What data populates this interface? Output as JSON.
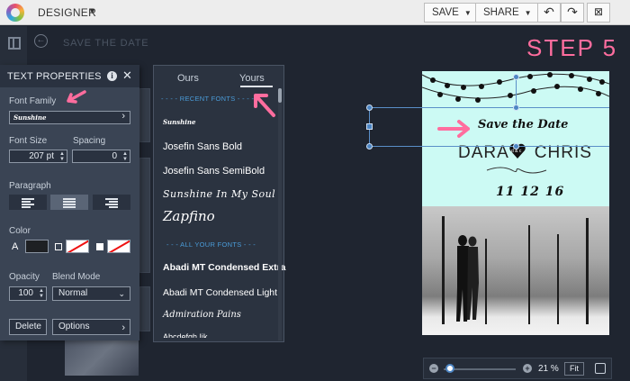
{
  "app": {
    "name": "DESIGNER"
  },
  "toolbar": {
    "save_label": "SAVE",
    "share_label": "SHARE"
  },
  "design_title": "SAVE THE DATE",
  "step_label": "STEP 5",
  "text_properties": {
    "title": "TEXT PROPERTIES",
    "font_family_label": "Font Family",
    "font_size_label": "Font Size",
    "font_size_value": "207 pt",
    "spacing_label": "Spacing",
    "spacing_value": "0",
    "paragraph_label": "Paragraph",
    "paragraph_align": "center",
    "color_label": "Color",
    "color_swatch_letter": "A",
    "text_color": "#1e2023",
    "opacity_label": "Opacity",
    "opacity_value": "100",
    "blend_mode_label": "Blend Mode",
    "blend_mode_value": "Normal",
    "delete_label": "Delete",
    "options_label": "Options"
  },
  "font_picker": {
    "tabs": [
      "Ours",
      "Yours"
    ],
    "active_tab": "Yours",
    "recent_header": "- - - - RECENT FONTS - - - -",
    "all_header": "- - - ALL YOUR FONTS - - -",
    "recent_fonts": [
      "Josefin Sans Bold",
      "Josefin Sans SemiBold",
      "Sunshine In My Soul",
      "Zapfino"
    ],
    "all_fonts": [
      "Abadi MT Condensed Extra",
      "Abadi MT Condensed Light",
      "Admiration Pains"
    ]
  },
  "card": {
    "heading": "Save the Date",
    "name_left": "DARA",
    "name_right": "CHRIS",
    "heart_initials": "d & c",
    "date": "11 12 16",
    "accent_color": "#ccfaf4"
  },
  "zoom": {
    "percent": "21 %",
    "fit_label": "Fit"
  },
  "colors": {
    "pink_accent": "#ff6d9e",
    "panel": "#3a4454",
    "link_blue": "#4a9bd8"
  }
}
